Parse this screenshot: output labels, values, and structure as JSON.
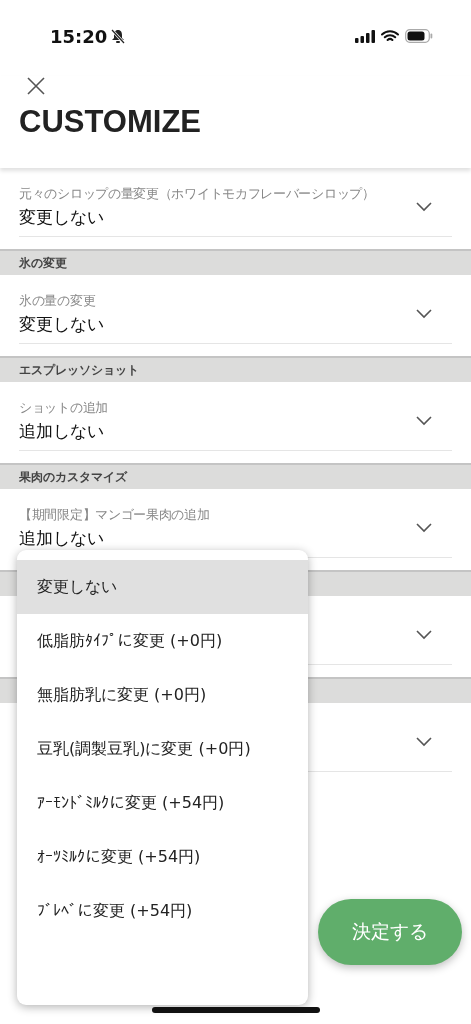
{
  "status_bar": {
    "time": "15:20"
  },
  "title": "CUSTOMIZE",
  "sections": [
    {
      "kind": "field",
      "label": "元々のシロップの量変更（ホワイトモカフレーバーシロップ）",
      "value": "変更しない"
    },
    {
      "kind": "header",
      "label": "氷の変更"
    },
    {
      "kind": "field",
      "label": "氷の量の変更",
      "value": "変更しない"
    },
    {
      "kind": "header",
      "label": "エスプレッソショット"
    },
    {
      "kind": "field",
      "label": "ショットの追加",
      "value": "追加しない"
    },
    {
      "kind": "header",
      "label": "果肉のカスタマイズ"
    },
    {
      "kind": "field",
      "label": "【期間限定】マンゴー果肉の追加",
      "value": "追加しない"
    },
    {
      "kind": "header"
    },
    {
      "kind": "field"
    },
    {
      "kind": "header"
    },
    {
      "kind": "field"
    }
  ],
  "menu": [
    {
      "label": "変更しない",
      "selected": true
    },
    {
      "label": "低脂肪ﾀｲﾌﾟに変更 (+0円)",
      "selected": false
    },
    {
      "label": "無脂肪乳に変更 (+0円)",
      "selected": false
    },
    {
      "label": "豆乳(調製豆乳)に変更 (+0円)",
      "selected": false
    },
    {
      "label": "ｱｰﾓﾝﾄﾞﾐﾙｸに変更 (+54円)",
      "selected": false
    },
    {
      "label": "ｵｰﾂﾐﾙｸに変更 (+54円)",
      "selected": false
    },
    {
      "label": "ﾌﾞﾚﾍﾞに変更 (+54円)",
      "selected": false
    }
  ],
  "confirm_button": "決定する"
}
